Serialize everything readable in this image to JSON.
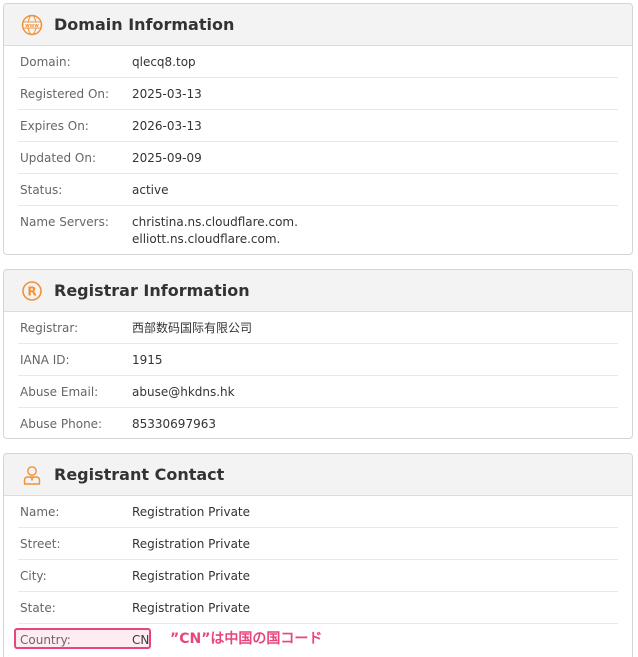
{
  "domain_info": {
    "title": "Domain Information",
    "icon": "www-globe-icon",
    "rows": [
      {
        "label": "Domain:",
        "value": "qlecq8.top"
      },
      {
        "label": "Registered On:",
        "value": "2025-03-13"
      },
      {
        "label": "Expires On:",
        "value": "2026-03-13"
      },
      {
        "label": "Updated On:",
        "value": "2025-09-09"
      },
      {
        "label": "Status:",
        "value": "active"
      }
    ],
    "name_servers_label": "Name Servers:",
    "name_servers": [
      "christina.ns.cloudflare.com.",
      "elliott.ns.cloudflare.com."
    ]
  },
  "registrar_info": {
    "title": "Registrar Information",
    "icon": "registered-icon",
    "rows": [
      {
        "label": "Registrar:",
        "value": "西部数码国际有限公司"
      },
      {
        "label": "IANA ID:",
        "value": "1915"
      },
      {
        "label": "Abuse Email:",
        "value": "abuse@hkdns.hk"
      },
      {
        "label": "Abuse Phone:",
        "value": "85330697963"
      }
    ]
  },
  "registrant_contact": {
    "title": "Registrant Contact",
    "icon": "person-icon",
    "rows": [
      {
        "label": "Name:",
        "value": "Registration Private"
      },
      {
        "label": "Street:",
        "value": "Registration Private"
      },
      {
        "label": "City:",
        "value": "Registration Private"
      },
      {
        "label": "State:",
        "value": "Registration Private"
      },
      {
        "label": "Country:",
        "value": "CN"
      }
    ]
  },
  "annotation": {
    "text": "”CN”は中国の国コード",
    "color": "#e8457a"
  },
  "colors": {
    "accent_icon": "#f0923a",
    "header_bg": "#f3f3f3"
  }
}
